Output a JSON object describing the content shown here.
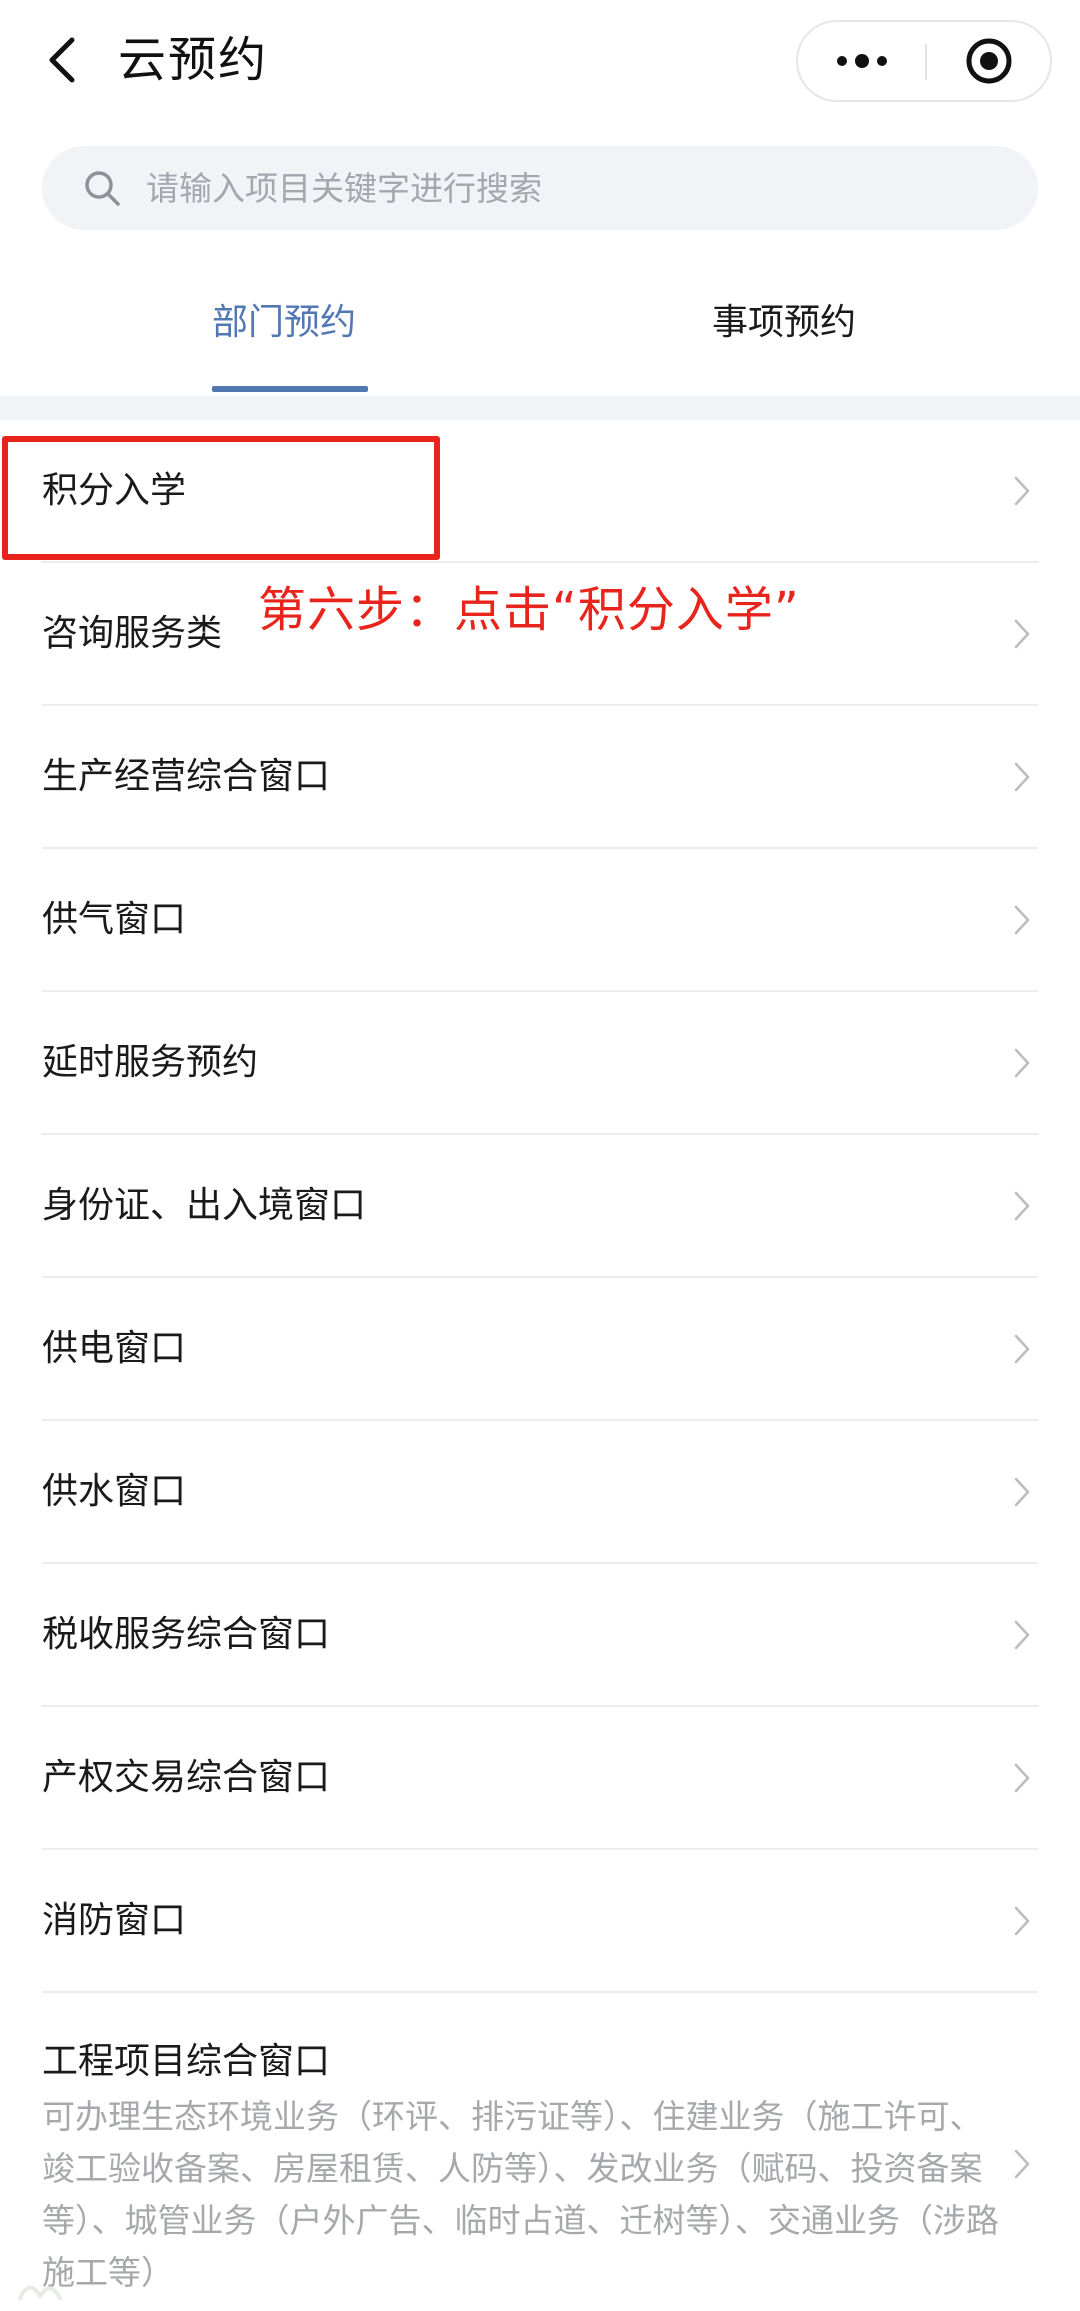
{
  "header": {
    "title": "云预约",
    "back_icon": "chevron-left-icon",
    "more_icon": "more-dots-icon",
    "close_icon": "target-circle-icon"
  },
  "search": {
    "placeholder": "请输入项目关键字进行搜索",
    "value": ""
  },
  "tabs": [
    {
      "label": "部门预约",
      "active": true
    },
    {
      "label": "事项预约",
      "active": false
    }
  ],
  "list": {
    "items": [
      {
        "label": "积分入学"
      },
      {
        "label": "咨询服务类"
      },
      {
        "label": "生产经营综合窗口"
      },
      {
        "label": "供气窗口"
      },
      {
        "label": "延时服务预约"
      },
      {
        "label": "身份证、出入境窗口"
      },
      {
        "label": "供电窗口"
      },
      {
        "label": "供水窗口"
      },
      {
        "label": "税收服务综合窗口"
      },
      {
        "label": "产权交易综合窗口"
      },
      {
        "label": "消防窗口"
      },
      {
        "label": "工程项目综合窗口",
        "description": "可办理生态环境业务（环评、排污证等）、住建业务（施工许可、竣工验收备案、房屋租赁、人防等）、发改业务（赋码、投资备案等）、城管业务（户外广告、临时占道、迁树等）、交通业务（涉路施工等）"
      }
    ]
  },
  "annotation": {
    "step_text": "第六步：点击“积分入学”",
    "color": "#e8241c"
  },
  "colors": {
    "accent": "#5278b4",
    "search_bg": "#f1f3f6",
    "muted_text": "#a6a8ac",
    "annotation": "#e8241c"
  }
}
